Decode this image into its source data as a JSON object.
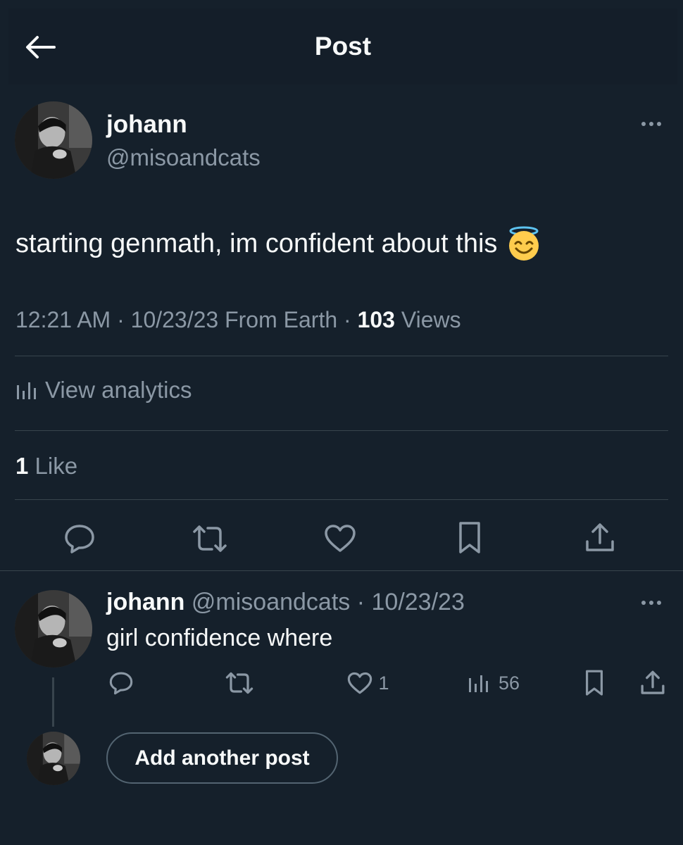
{
  "header": {
    "title": "Post",
    "back_icon": "arrow-left-icon"
  },
  "post": {
    "author_name": "johann",
    "author_handle": "@misoandcats",
    "text": "starting genmath, im confident about this",
    "emoji": "smiling-face-with-halo-icon",
    "time": "12:21 AM",
    "date": "10/23/23",
    "source": "From Earth",
    "views_count": "103",
    "views_label": "Views",
    "analytics_label": "View analytics",
    "likes_count": "1",
    "likes_label": "Like"
  },
  "actions": [
    "reply-icon",
    "repost-icon",
    "like-icon",
    "bookmark-icon",
    "share-icon"
  ],
  "reply": {
    "author_name": "johann",
    "author_handle": "@misoandcats",
    "date": "10/23/23",
    "text": "girl confidence where",
    "like_count": "1",
    "views_count": "56"
  },
  "composer": {
    "button_label": "Add another post"
  },
  "colors": {
    "background": "#15202b",
    "text": "#f7f9f9",
    "muted": "#8b98a5",
    "divider": "#38444d"
  }
}
